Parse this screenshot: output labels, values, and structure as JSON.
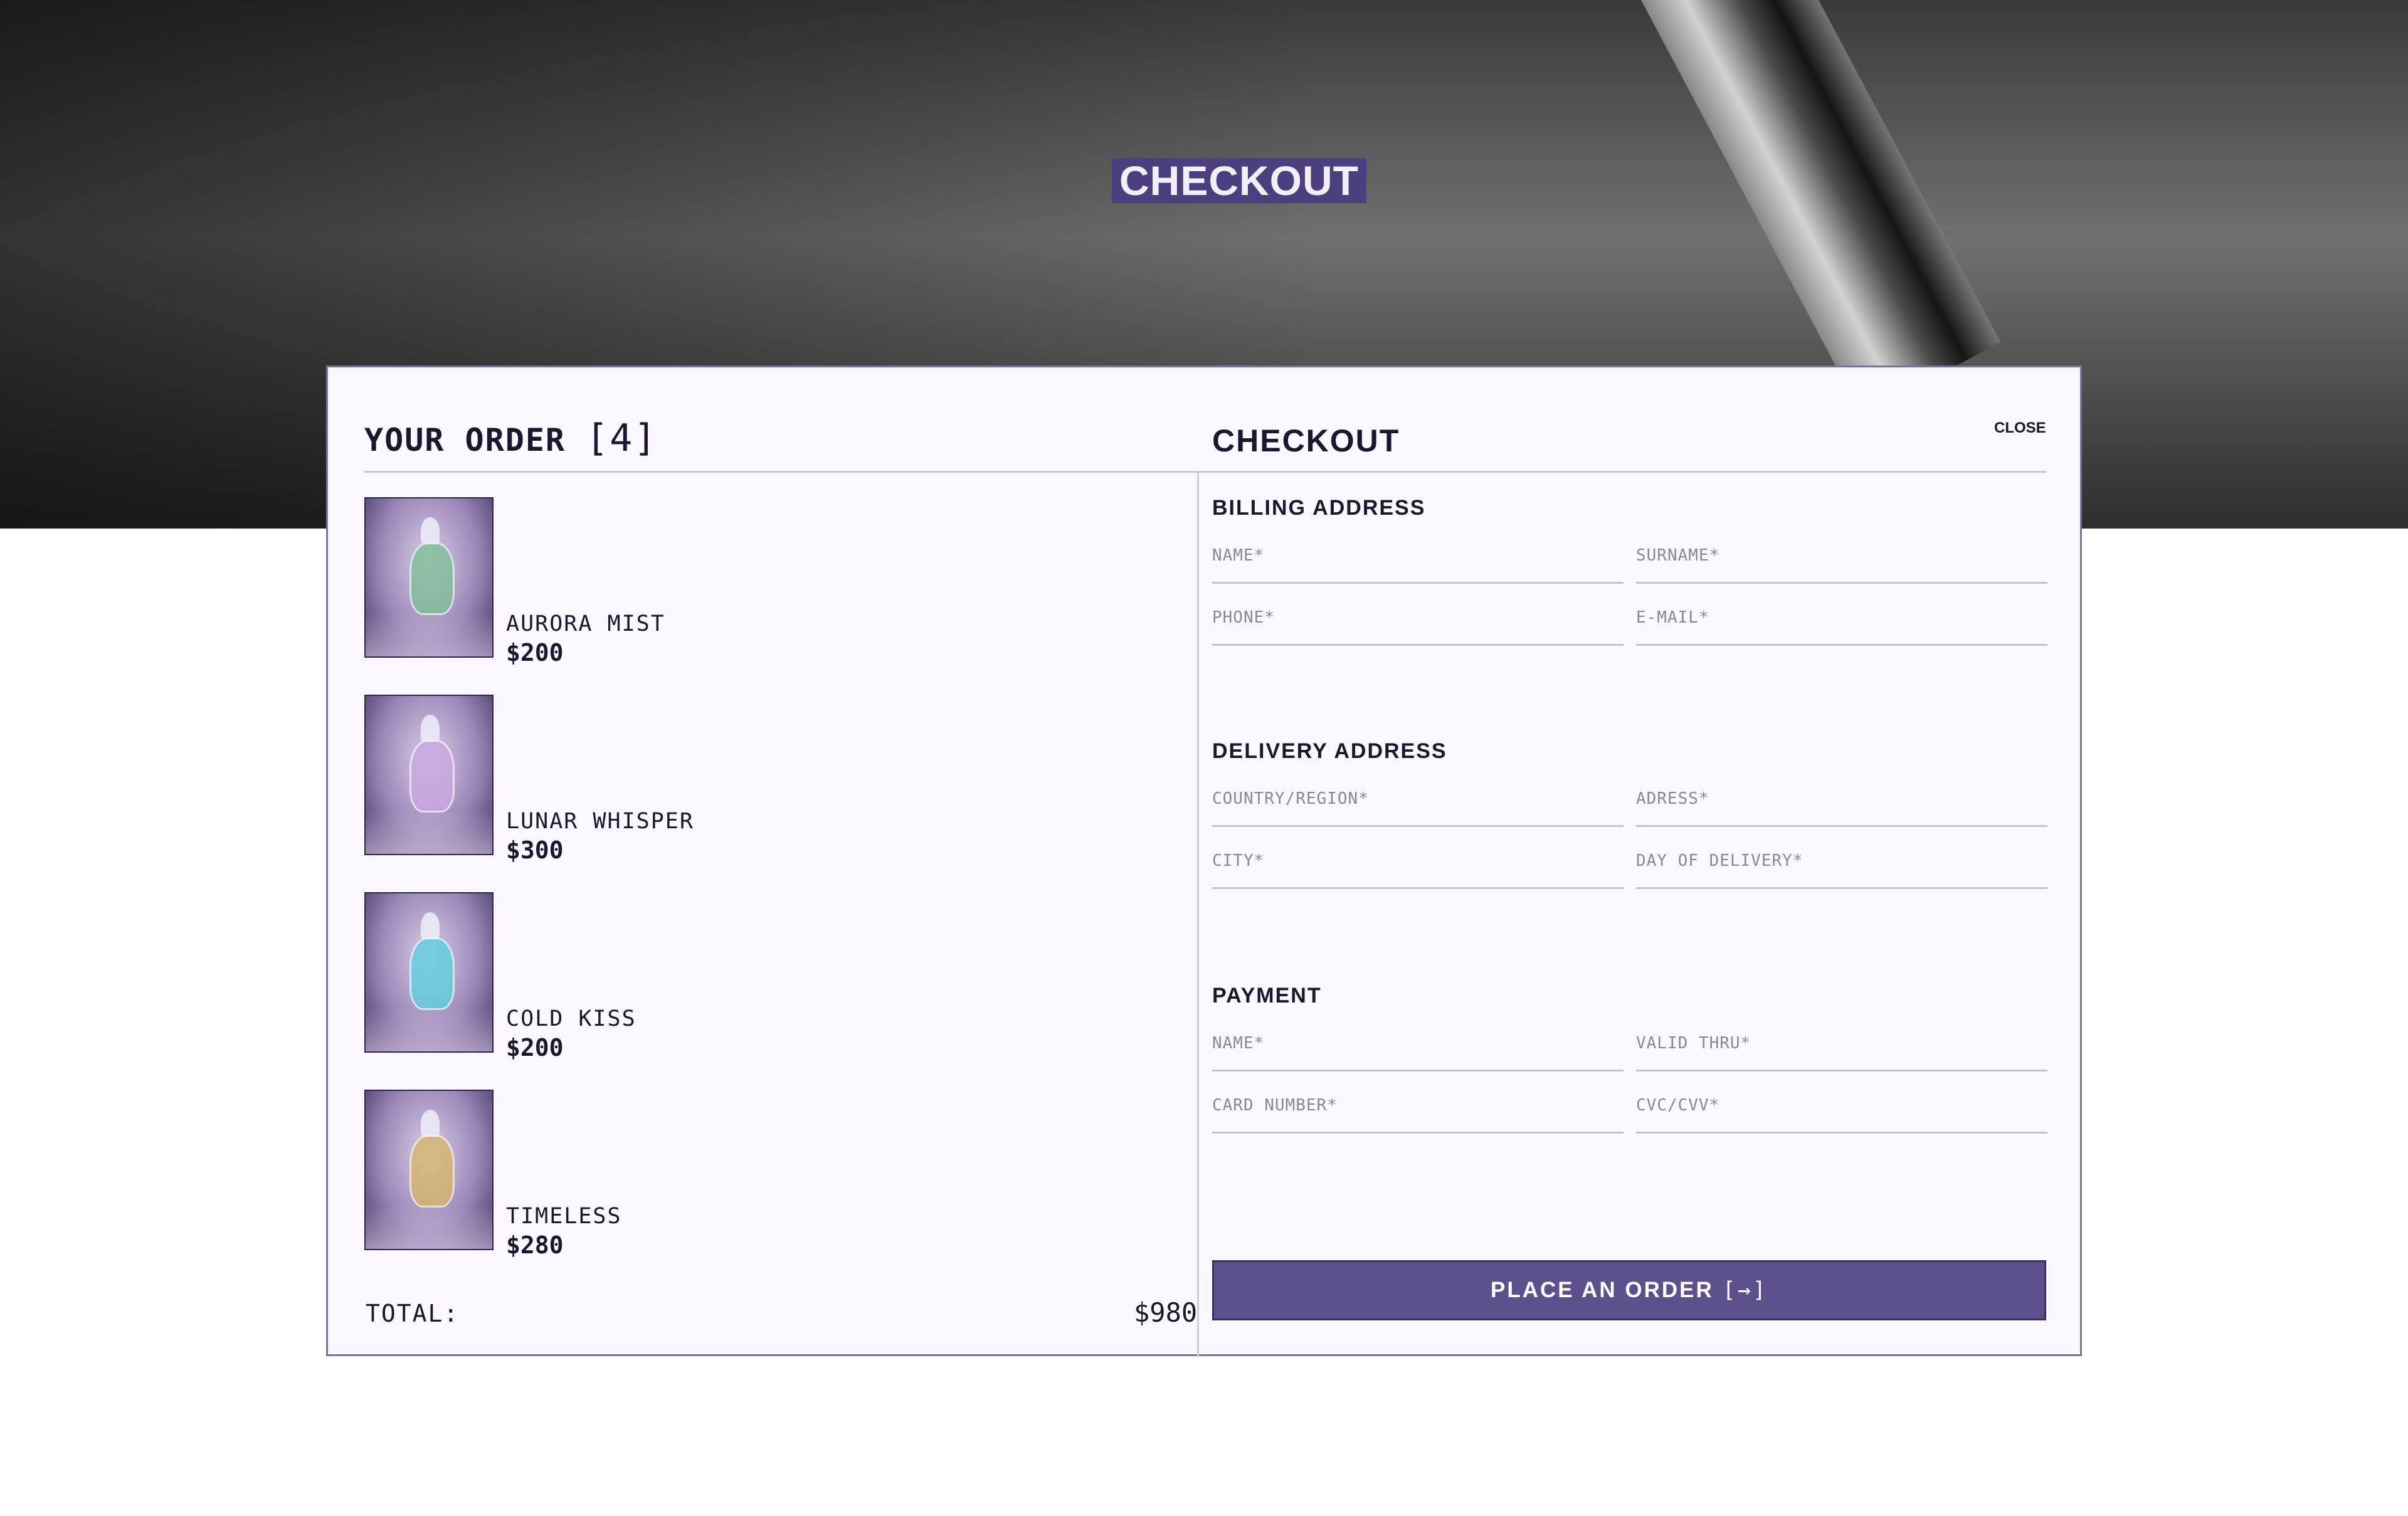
{
  "hero": {
    "title": "CHECKOUT"
  },
  "order": {
    "heading": "YOUR ORDER",
    "count": "[4]",
    "items": [
      {
        "name": "AURORA MIST",
        "price": "$200",
        "accent": "#7fbf9a"
      },
      {
        "name": "LUNAR WHISPER",
        "price": "$300",
        "accent": "#c9a8e0"
      },
      {
        "name": "COLD KISS",
        "price": "$200",
        "accent": "#5fd0dc"
      },
      {
        "name": "TIMELESS",
        "price": "$280",
        "accent": "#d6b56a"
      }
    ],
    "total_label": "TOTAL:",
    "total_value": "$980"
  },
  "checkout": {
    "heading": "CHECKOUT",
    "close_label": "CLOSE",
    "billing": {
      "title": "BILLING ADDRESS",
      "name": "NAME*",
      "surname": "SURNAME*",
      "phone": "PHONE*",
      "email": "E-MAIL*"
    },
    "delivery": {
      "title": "DELIVERY ADDRESS",
      "country": "COUNTRY/REGION*",
      "address": "ADRESS*",
      "city": "CITY*",
      "day": "DAY OF DELIVERY*"
    },
    "payment": {
      "title": "PAYMENT",
      "name": "NAME*",
      "valid_thru": "VALID THRU*",
      "card_number": "CARD NUMBER*",
      "cvc": "CVC/CVV*"
    },
    "place_order_label": "PLACE AN ORDER",
    "place_order_icon": "[→]"
  },
  "colors": {
    "accent": "#5d508c",
    "brand_dark": "#4b3f7f",
    "panel_bg": "#faf8fe"
  }
}
